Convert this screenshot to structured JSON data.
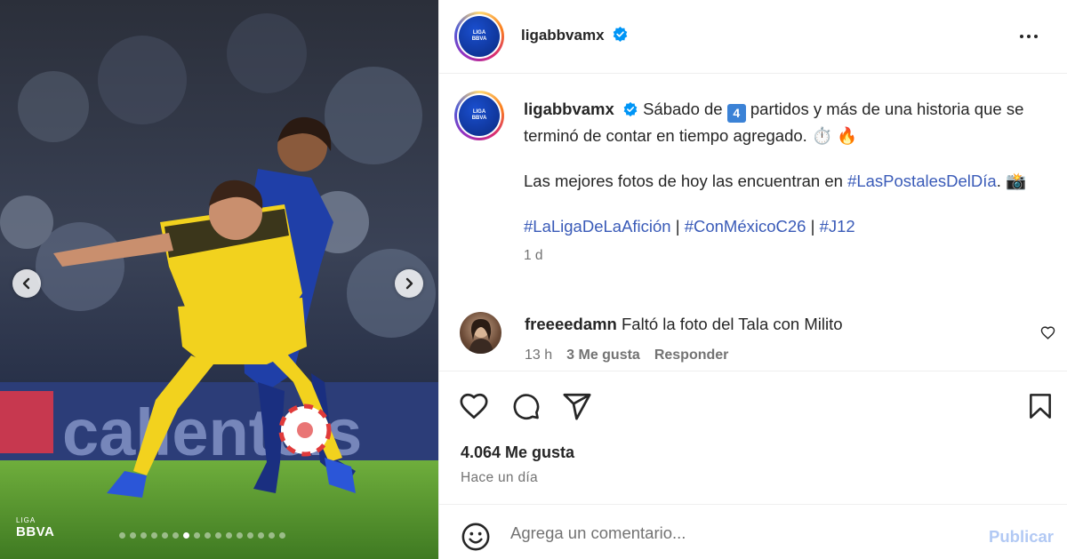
{
  "post": {
    "username": "ligabbvamx",
    "verified": true,
    "avatar_text_top": "LIGA",
    "avatar_text_bottom": "BBVA",
    "caption_line1_a": "Sábado de",
    "caption_emoji_number": "4",
    "caption_line1_b": "partidos y más de una historia que se terminó de contar en tiempo agregado. ⏱️ 🔥",
    "caption_line2_a": "Las mejores fotos de hoy las encuentran en",
    "caption_line2_hashtag": "#LasPostalesDelDía",
    "caption_line2_b": ". 📸",
    "hashtags": [
      "#LaLigaDeLaAfición",
      "#ConMéxicoC26",
      "#J12"
    ],
    "hashtag_separator": " | ",
    "time_ago": "1 d"
  },
  "photo": {
    "watermark_liga": "LIGA",
    "watermark_bbva": "BBVA",
    "carousel_total": 16,
    "carousel_active_index": 6,
    "prev_icon": "chevron-left-icon",
    "next_icon": "chevron-right-icon"
  },
  "comment": {
    "username": "freeeedamn",
    "text": "Faltó la foto del Tala con Milito",
    "time": "13 h",
    "likes": "3 Me gusta",
    "reply": "Responder"
  },
  "actions": {
    "icons": [
      "heart-icon",
      "comment-icon",
      "share-icon",
      "bookmark-icon"
    ],
    "likes_count": "4.064 Me gusta",
    "date": "Hace un día"
  },
  "comment_box": {
    "placeholder": "Agrega un comentario...",
    "publish_label": "Publicar"
  },
  "colors": {
    "hashtag": "#3a5bb8",
    "verified": "#0095f6",
    "publish_disabled": "#b2c9f4",
    "muted": "#737373"
  }
}
